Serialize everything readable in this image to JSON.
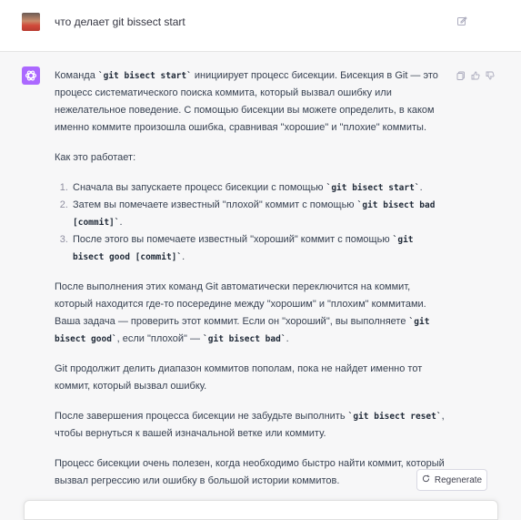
{
  "user_message": {
    "text": "что делает git bissect start",
    "icons": {
      "edit": "edit-icon"
    }
  },
  "assistant": {
    "avatar_icon": "openai-logo-icon",
    "avatar_color": "#ab68ff",
    "p1": {
      "t1": "Команда ",
      "c1": "`git bisect start`",
      "t2": " инициирует процесс бисекции. Бисекция в Git — это процесс систематического поиска коммита, который вызвал ошибку или нежелательное поведение. С помощью бисекции вы можете определить, в каком именно коммите произошла ошибка, сравнивая \"хорошие\" и \"плохие\" коммиты."
    },
    "p2": "Как это работает:",
    "steps": [
      {
        "t1": "Сначала вы запускаете процесс бисекции с помощью ",
        "c1": "`git bisect start`",
        "t2": "."
      },
      {
        "t1": "Затем вы помечаете известный \"плохой\" коммит с помощью ",
        "c1": "`git bisect bad [commit]`",
        "t2": "."
      },
      {
        "t1": "После этого вы помечаете известный \"хороший\" коммит с помощью ",
        "c1": "`git bisect good [commit]`",
        "t2": "."
      }
    ],
    "p3": {
      "t1": "После выполнения этих команд Git автоматически переключится на коммит, который находится где-то посередине между \"хорошим\" и \"плохим\" коммитами. Ваша задача — проверить этот коммит. Если он \"хороший\", вы выполняете ",
      "c1": "`git bisect good`",
      "t2": ", если \"плохой\" — ",
      "c2": "`git bisect bad`",
      "t3": "."
    },
    "p4": "Git продолжит делить диапазон коммитов пополам, пока не найдет именно тот коммит, который вызвал ошибку.",
    "p5": {
      "t1": "После завершения процесса бисекции не забудьте выполнить ",
      "c1": "`git bisect reset`",
      "t2": ", чтобы вернуться к вашей изначальной ветке или коммиту."
    },
    "p6": "Процесс бисекции очень полезен, когда необходимо быстро найти коммит, который вызвал регрессию или ошибку в большой истории коммитов.",
    "actions": [
      "copy-icon",
      "thumbs-up-icon",
      "thumbs-down-icon"
    ]
  },
  "regenerate": {
    "label": "Regenerate",
    "icon": "refresh-icon"
  }
}
